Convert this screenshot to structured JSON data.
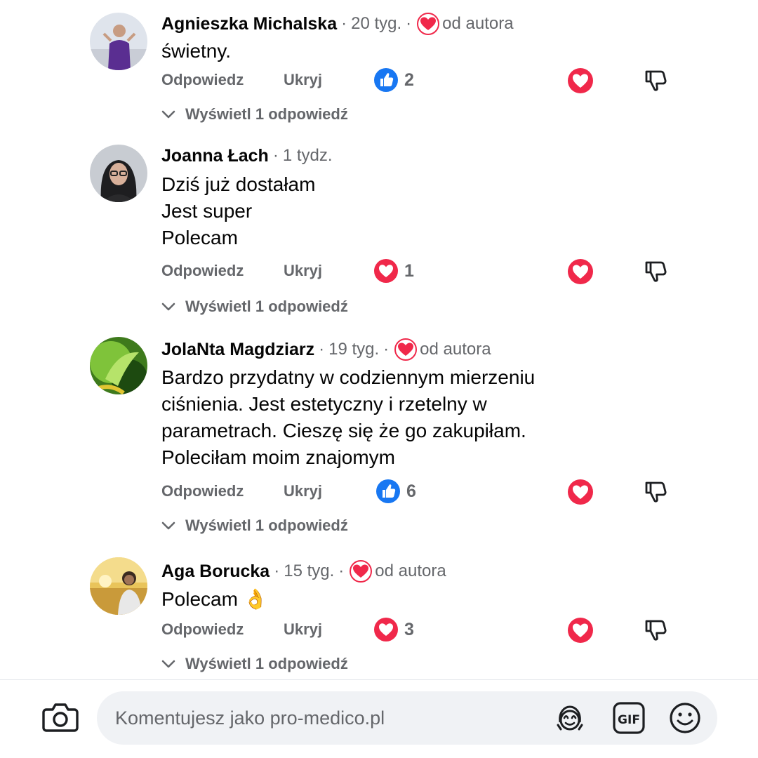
{
  "labels": {
    "reply": "Odpowiedz",
    "hide": "Ukryj",
    "view_replies": "Wyświetl 1 odpowiedź",
    "liked_by_author": "od autora"
  },
  "comments": [
    {
      "author": "Agnieszka Michalska",
      "time": "20 tyg.",
      "liked_by_author": true,
      "lines": [
        "świetny."
      ],
      "reaction": {
        "type": "like",
        "count": "2"
      }
    },
    {
      "author": "Joanna Łach",
      "time": "1 tydz.",
      "liked_by_author": false,
      "lines": [
        "Dziś już dostałam",
        "Jest super",
        "Polecam"
      ],
      "reaction": {
        "type": "love",
        "count": "1"
      }
    },
    {
      "author": "JolaNta Magdziarz",
      "time": "19 tyg.",
      "liked_by_author": true,
      "lines": [
        "Bardzo przydatny w codziennym mierzeniu",
        "ciśnienia. Jest estetyczny i rzetelny w",
        "parametrach. Cieszę się że go zakupiłam.",
        "Poleciłam moim znajomym"
      ],
      "reaction": {
        "type": "like",
        "count": "6"
      }
    },
    {
      "author": "Aga Borucka",
      "time": "15 tyg.",
      "liked_by_author": true,
      "lines": [
        "Polecam 👌"
      ],
      "reaction": {
        "type": "love",
        "count": "3"
      }
    }
  ],
  "composer": {
    "placeholder": "Komentujesz jako pro-medico.pl",
    "tools": [
      "avatar-sticker-icon",
      "gif-icon",
      "emoji-icon"
    ]
  },
  "colors": {
    "love_red": "#f0284a",
    "like_blue": "#1877f2",
    "muted_text": "#65676b",
    "input_bg": "#f0f2f5"
  }
}
